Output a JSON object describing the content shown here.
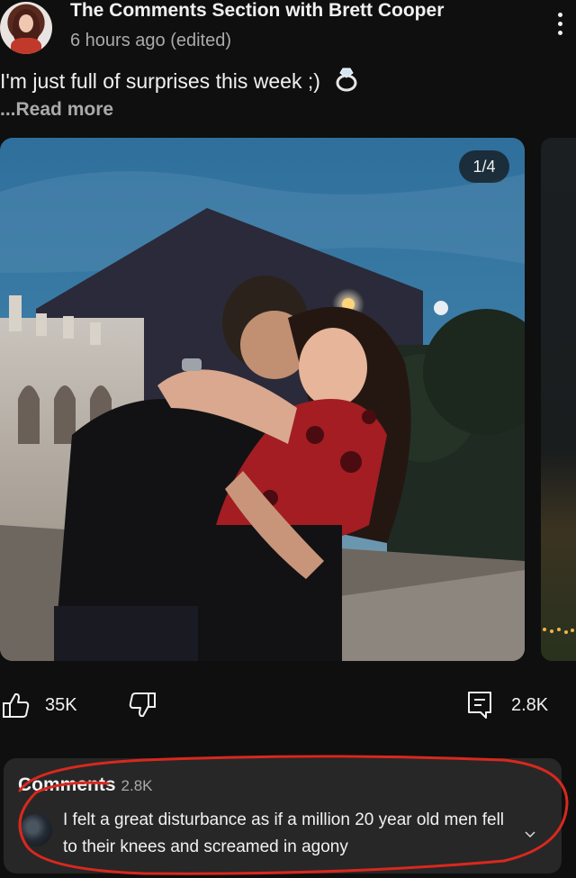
{
  "header": {
    "channel_name": "The Comments Section with Brett Cooper",
    "post_time": "6 hours ago (edited)",
    "avatar_icon": "channel-avatar",
    "menu_icon": "more-vert-icon"
  },
  "post": {
    "text": "I'm just full of surprises this week ;)",
    "emoji_icon": "ring-icon",
    "read_more": "...Read more",
    "image_counter": "1/4"
  },
  "actions": {
    "like_count": "35K",
    "comment_count": "2.8K",
    "like_icon": "thumbs-up-icon",
    "dislike_icon": "thumbs-down-icon",
    "comments_icon": "comments-icon"
  },
  "comments_panel": {
    "heading": "Comments",
    "count": "2.8K",
    "top_comment": "I felt a great disturbance as if a million 20 year old men fell to their knees and screamed in agony"
  },
  "colors": {
    "background": "#0f0f0f",
    "panel": "#272727",
    "text_primary": "#f1f1f1",
    "text_secondary": "#aaaaaa",
    "annotation": "#d9281e"
  }
}
